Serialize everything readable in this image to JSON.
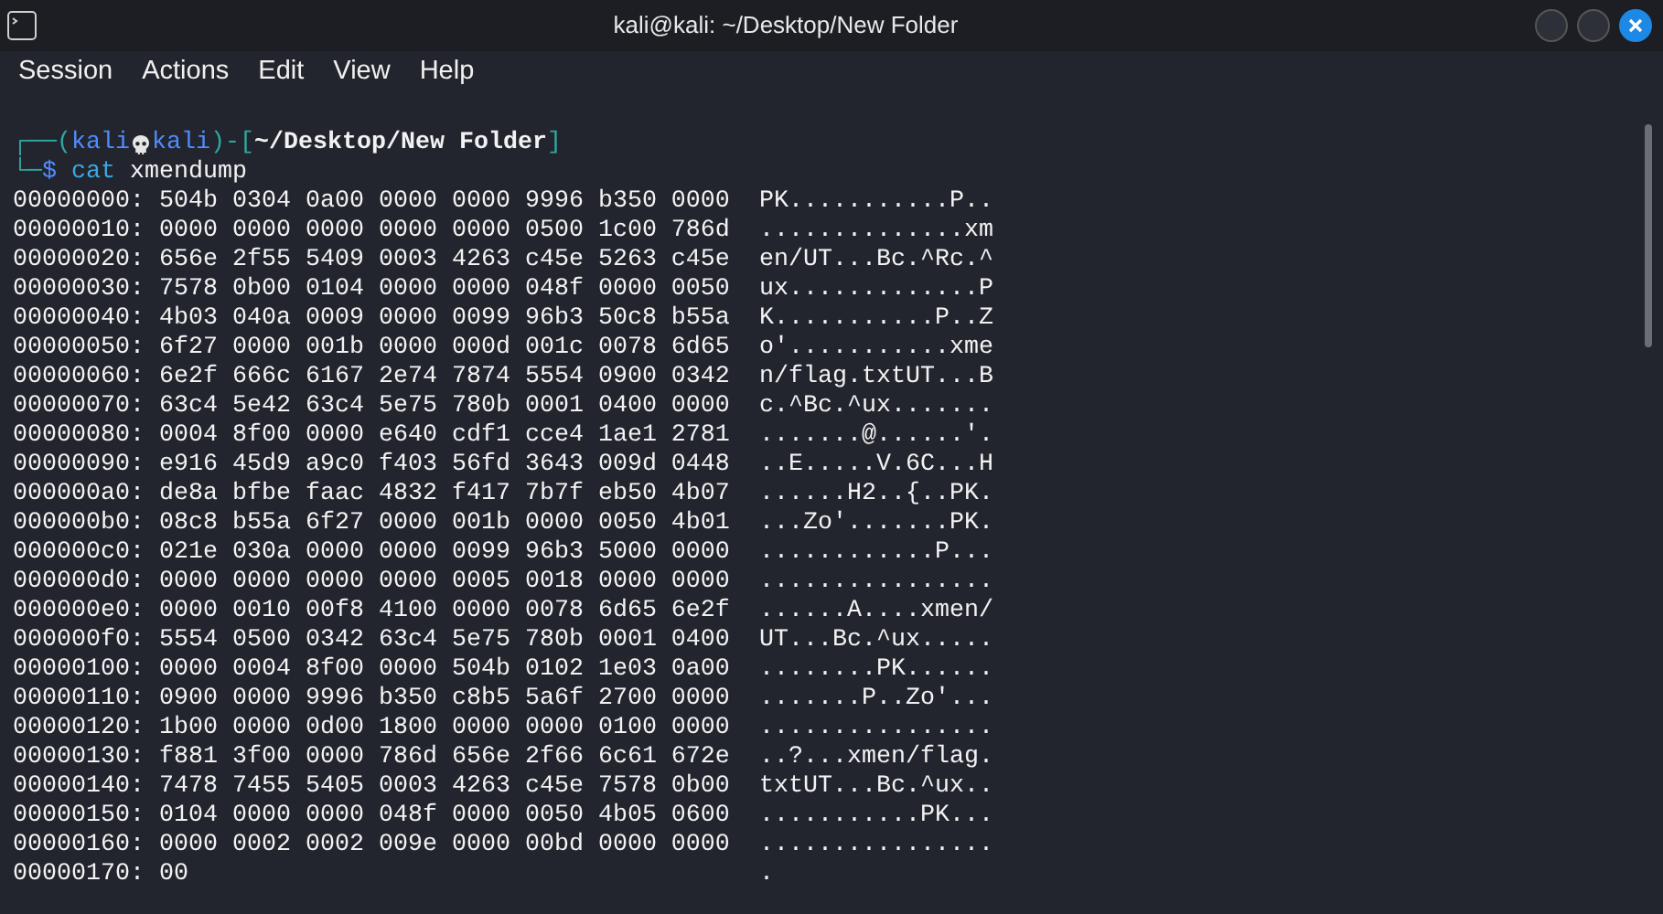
{
  "window": {
    "title": "kali@kali: ~/Desktop/New Folder"
  },
  "menu": [
    "Session",
    "Actions",
    "Edit",
    "View",
    "Help"
  ],
  "prompt": {
    "open": "┌──(",
    "user": "kali",
    "host": "kali",
    "mid": ")-[",
    "path": "~/Desktop/New Folder",
    "close": "]",
    "corner": "└─",
    "symbol": "$",
    "command": "cat",
    "argument": "xmendump"
  },
  "dump": [
    {
      "offset": "00000000:",
      "hex": "504b 0304 0a00 0000 0000 9996 b350 0000",
      "ascii": "PK...........P.."
    },
    {
      "offset": "00000010:",
      "hex": "0000 0000 0000 0000 0000 0500 1c00 786d",
      "ascii": "..............xm"
    },
    {
      "offset": "00000020:",
      "hex": "656e 2f55 5409 0003 4263 c45e 5263 c45e",
      "ascii": "en/UT...Bc.^Rc.^"
    },
    {
      "offset": "00000030:",
      "hex": "7578 0b00 0104 0000 0000 048f 0000 0050",
      "ascii": "ux.............P"
    },
    {
      "offset": "00000040:",
      "hex": "4b03 040a 0009 0000 0099 96b3 50c8 b55a",
      "ascii": "K...........P..Z"
    },
    {
      "offset": "00000050:",
      "hex": "6f27 0000 001b 0000 000d 001c 0078 6d65",
      "ascii": "o'...........xme"
    },
    {
      "offset": "00000060:",
      "hex": "6e2f 666c 6167 2e74 7874 5554 0900 0342",
      "ascii": "n/flag.txtUT...B"
    },
    {
      "offset": "00000070:",
      "hex": "63c4 5e42 63c4 5e75 780b 0001 0400 0000",
      "ascii": "c.^Bc.^ux......."
    },
    {
      "offset": "00000080:",
      "hex": "0004 8f00 0000 e640 cdf1 cce4 1ae1 2781",
      "ascii": ".......@......'."
    },
    {
      "offset": "00000090:",
      "hex": "e916 45d9 a9c0 f403 56fd 3643 009d 0448",
      "ascii": "..E.....V.6C...H"
    },
    {
      "offset": "000000a0:",
      "hex": "de8a bfbe faac 4832 f417 7b7f eb50 4b07",
      "ascii": "......H2..{..PK."
    },
    {
      "offset": "000000b0:",
      "hex": "08c8 b55a 6f27 0000 001b 0000 0050 4b01",
      "ascii": "...Zo'.......PK."
    },
    {
      "offset": "000000c0:",
      "hex": "021e 030a 0000 0000 0099 96b3 5000 0000",
      "ascii": "............P..."
    },
    {
      "offset": "000000d0:",
      "hex": "0000 0000 0000 0000 0005 0018 0000 0000",
      "ascii": "................"
    },
    {
      "offset": "000000e0:",
      "hex": "0000 0010 00f8 4100 0000 0078 6d65 6e2f",
      "ascii": "......A....xmen/"
    },
    {
      "offset": "000000f0:",
      "hex": "5554 0500 0342 63c4 5e75 780b 0001 0400",
      "ascii": "UT...Bc.^ux....."
    },
    {
      "offset": "00000100:",
      "hex": "0000 0004 8f00 0000 504b 0102 1e03 0a00",
      "ascii": "........PK......"
    },
    {
      "offset": "00000110:",
      "hex": "0900 0000 9996 b350 c8b5 5a6f 2700 0000",
      "ascii": ".......P..Zo'..."
    },
    {
      "offset": "00000120:",
      "hex": "1b00 0000 0d00 1800 0000 0000 0100 0000",
      "ascii": "................"
    },
    {
      "offset": "00000130:",
      "hex": "f881 3f00 0000 786d 656e 2f66 6c61 672e",
      "ascii": "..?...xmen/flag."
    },
    {
      "offset": "00000140:",
      "hex": "7478 7455 5405 0003 4263 c45e 7578 0b00",
      "ascii": "txtUT...Bc.^ux.."
    },
    {
      "offset": "00000150:",
      "hex": "0104 0000 0000 048f 0000 0050 4b05 0600",
      "ascii": "...........PK..."
    },
    {
      "offset": "00000160:",
      "hex": "0000 0002 0002 009e 0000 00bd 0000 0000",
      "ascii": "................"
    },
    {
      "offset": "00000170:",
      "hex": "00",
      "ascii": "."
    }
  ]
}
